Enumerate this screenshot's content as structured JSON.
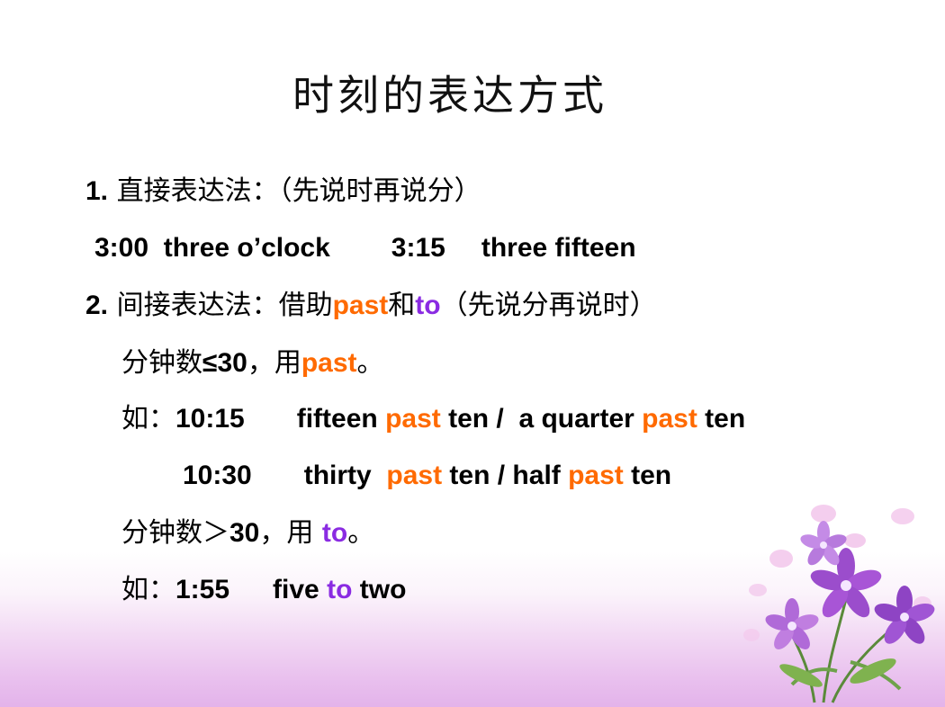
{
  "title": "时刻的表达方式",
  "line1": {
    "num": "1.",
    "text": " 直接表达法：（先说时再说分）"
  },
  "line2": {
    "t1": "3:00",
    "w1": "three o’clock",
    "t2": "3:15",
    "w2": "three fifteen"
  },
  "line3": {
    "num": "2.",
    "pre": " 间接表达法：借助",
    "past": "past",
    "and": "和",
    "to": "to",
    "post": "（先说分再说时）"
  },
  "line4": {
    "pre": "分钟数",
    "cond": "≤30",
    "mid": "，用",
    "past": "past",
    "end": "。"
  },
  "line5": {
    "ru": "如：",
    "time": "10:15",
    "w1": "fifteen ",
    "past1": "past",
    "w2": " ten /  a quarter ",
    "past2": "past",
    "w3": " ten"
  },
  "line6": {
    "time": "10:30",
    "w1": "thirty  ",
    "past1": "past",
    "w2": " ten / half ",
    "past2": "past",
    "w3": " ten"
  },
  "line7": {
    "pre": "分钟数＞",
    "cond": "30",
    "mid": "，用 ",
    "to": "to",
    "end": "。"
  },
  "line8": {
    "ru": "如：",
    "time": "1:55",
    "w1": "five ",
    "to": "to",
    "w2": " two"
  },
  "colors": {
    "past": "#ff6a00",
    "to": "#8a2be2",
    "bottom_gradient": "#e3b3ea"
  },
  "decoration": {
    "icon": "purple-flowers-icon"
  }
}
